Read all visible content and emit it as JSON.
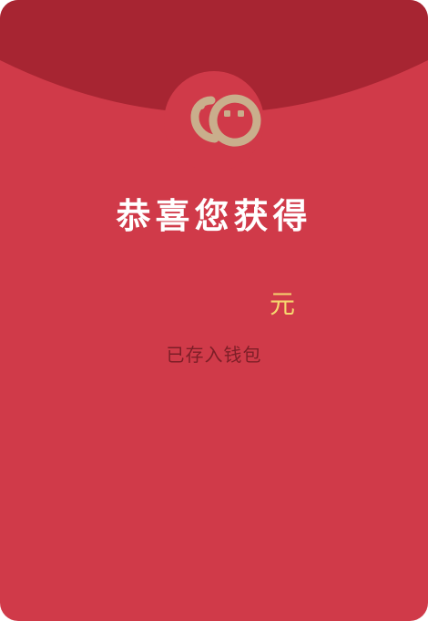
{
  "packet": {
    "logo_icon": "smiling-faces-logo-icon",
    "title": "恭喜您获得",
    "amount": "",
    "unit": "元",
    "status": "已存入钱包"
  },
  "colors": {
    "packet_red": "#d03a49",
    "flap_red": "#a72532",
    "logo_gold": "#c9ae8c",
    "amount_gold": "#f6d76f",
    "status_text": "#7d1e27"
  }
}
